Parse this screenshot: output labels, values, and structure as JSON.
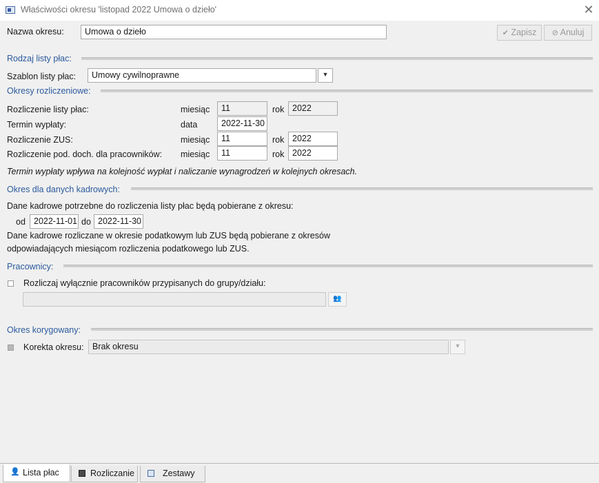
{
  "window": {
    "title": "Właściwości okresu 'listopad 2022 Umowa o dzieło'"
  },
  "header": {
    "name_label": "Nazwa okresu:",
    "name_value": "Umowa o dzieło",
    "save_label": "Zapisz",
    "cancel_label": "Anuluj"
  },
  "rodzaj": {
    "title": "Rodzaj listy płac:",
    "template_label": "Szablon listy płac:",
    "template_value": "Umowy cywilnoprawne"
  },
  "okresy": {
    "title": "Okresy rozliczeniowe:",
    "rows": [
      {
        "label": "Rozliczenie listy płac:",
        "unit": "miesiąc",
        "value": "11",
        "year_label": "rok",
        "year": "2022"
      },
      {
        "label": "Termin wypłaty:",
        "unit": "data",
        "value": "2022-11-30"
      },
      {
        "label": "Rozliczenie ZUS:",
        "unit": "miesiąc",
        "value": "11",
        "year_label": "rok",
        "year": "2022"
      },
      {
        "label": "Rozliczenie pod. doch. dla pracowników:",
        "unit": "miesiąc",
        "value": "11",
        "year_label": "rok",
        "year": "2022"
      }
    ],
    "note": "Termin wypłaty wpływa na kolejność wypłat i naliczanie wynagrodzeń w kolejnych okresach."
  },
  "kadrowe": {
    "title": "Okres dla danych kadrowych:",
    "desc": "Dane kadrowe potrzebne do rozliczenia listy płac będą pobierane z okresu:",
    "from_label": "od",
    "from": "2022-11-01",
    "to_label": "do",
    "to": "2022-11-30",
    "note_line1": "Dane kadrowe rozliczane w okresie podatkowym lub ZUS będą pobierane z okresów",
    "note_line2": "odpowiadających miesiącom rozliczenia podatkowego lub ZUS."
  },
  "pracownicy": {
    "title": "Pracownicy:",
    "checkbox_label": "Rozliczaj wyłącznie pracowników przypisanych do grupy/działu:",
    "group_value": ""
  },
  "korygowany": {
    "title": "Okres korygowany:",
    "label": "Korekta okresu:",
    "value": "Brak okresu"
  },
  "tabs": [
    {
      "label": "Lista płac",
      "icon": "person-icon"
    },
    {
      "label": "Rozliczanie",
      "icon": "calculator-icon"
    },
    {
      "label": "Zestawy",
      "icon": "report-icon"
    }
  ]
}
